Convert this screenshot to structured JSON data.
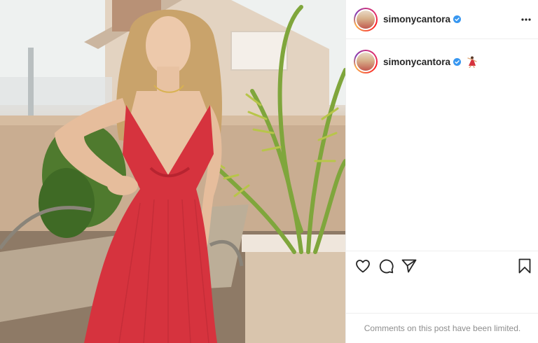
{
  "post": {
    "image_alt": "Woman in a long red dress posing on a terrace",
    "username": "simonycantora",
    "verified": true,
    "caption_emoji": "dancer-emoji"
  },
  "actions": {
    "like_icon": "heart-icon",
    "comment_icon": "comment-icon",
    "share_icon": "paper-plane-icon",
    "save_icon": "bookmark-icon"
  },
  "footer": {
    "comments_notice": "Comments on this post have been limited."
  },
  "colors": {
    "verified_blue": "#3897f0",
    "text": "#262626",
    "muted": "#8e8e8e",
    "dress_red": "#d6333e"
  }
}
